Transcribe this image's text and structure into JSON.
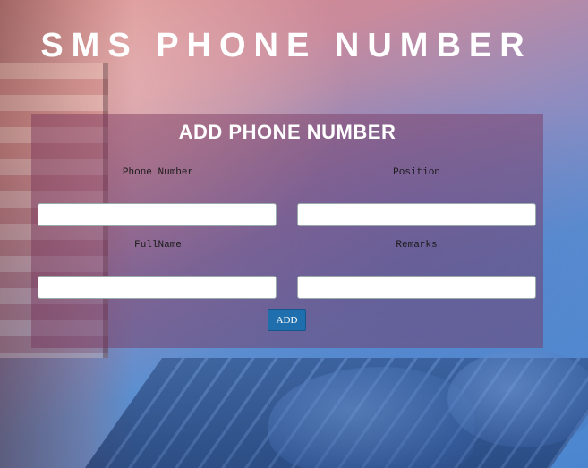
{
  "page": {
    "title": "SMS PHONE NUMBER"
  },
  "form": {
    "title": "ADD PHONE NUMBER",
    "fields": {
      "phone_number": {
        "label": "Phone Number",
        "value": "",
        "placeholder": ""
      },
      "position": {
        "label": "Position",
        "value": "",
        "placeholder": ""
      },
      "full_name": {
        "label": "FullName",
        "value": "",
        "placeholder": ""
      },
      "remarks": {
        "label": "Remarks",
        "value": "",
        "placeholder": ""
      }
    },
    "add_button_label": "ADD"
  },
  "colors": {
    "panel_overlay": "#78325a",
    "button": "#1f6fae",
    "title_text": "#ffffff"
  }
}
